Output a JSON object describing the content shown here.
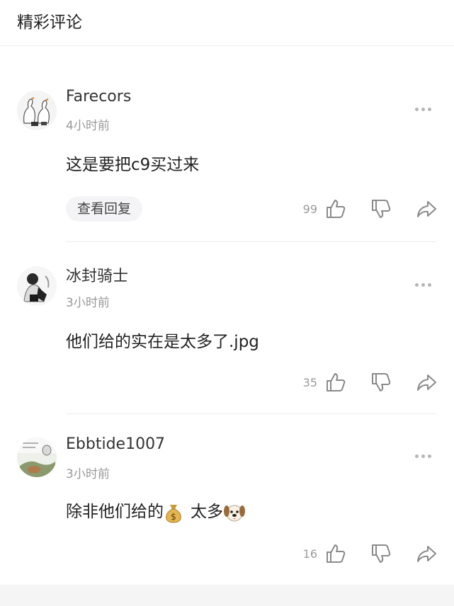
{
  "header": {
    "title": "精彩评论"
  },
  "comments": [
    {
      "username": "Farecors",
      "time": "4小时前",
      "text": "这是要把c9买过来",
      "reply_label": "查看回复",
      "likes": "99"
    },
    {
      "username": "冰封骑士",
      "time": "3小时前",
      "text": "他们给的实在是太多了.jpg",
      "likes": "35"
    },
    {
      "username": "Ebbtide1007",
      "time": "3小时前",
      "text_part1": "除非他们给的",
      "text_part2": "太多",
      "text_emoji1": "money-bag",
      "text_emoji2": "dog-face",
      "likes": "16"
    }
  ],
  "icons": {
    "more": "more-dots-icon",
    "like": "thumbs-up-icon",
    "dislike": "thumbs-down-icon",
    "share": "share-icon"
  }
}
